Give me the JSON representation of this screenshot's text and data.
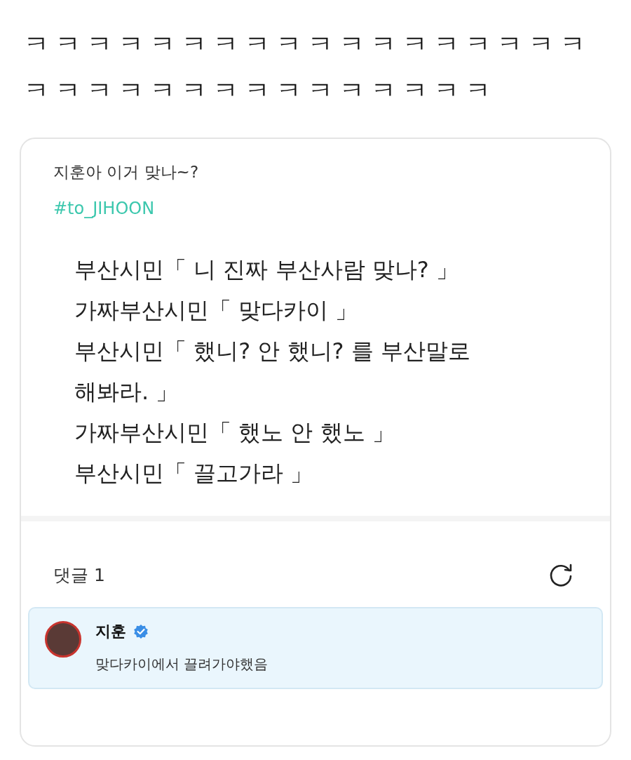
{
  "laugh_lines": [
    "ㅋㅋㅋㅋㅋㅋㅋㅋㅋㅋㅋㅋㅋㅋㅋㅋㅋㅋ",
    "ㅋㅋㅋㅋㅋㅋㅋㅋㅋㅋㅋㅋㅋㅋㅋ"
  ],
  "post": {
    "caption": "지훈아 이거 맞나~?",
    "hashtag": "#to_JIHOON",
    "body_lines": [
      "부산시민「 니 진짜 부산사람 맞나? 」",
      "가짜부산시민「 맞다카이 」",
      "부산시민「 했니? 안 했니? 를 부산말로",
      "해봐라. 」",
      "가짜부산시민「 했노 안 했노 」",
      "부산시민「 끌고가라 」"
    ]
  },
  "comments_header": {
    "label": "댓글 1"
  },
  "comments": [
    {
      "author": "지훈",
      "verified": true,
      "text": "맞다카이에서 끌려가야했음"
    }
  ]
}
